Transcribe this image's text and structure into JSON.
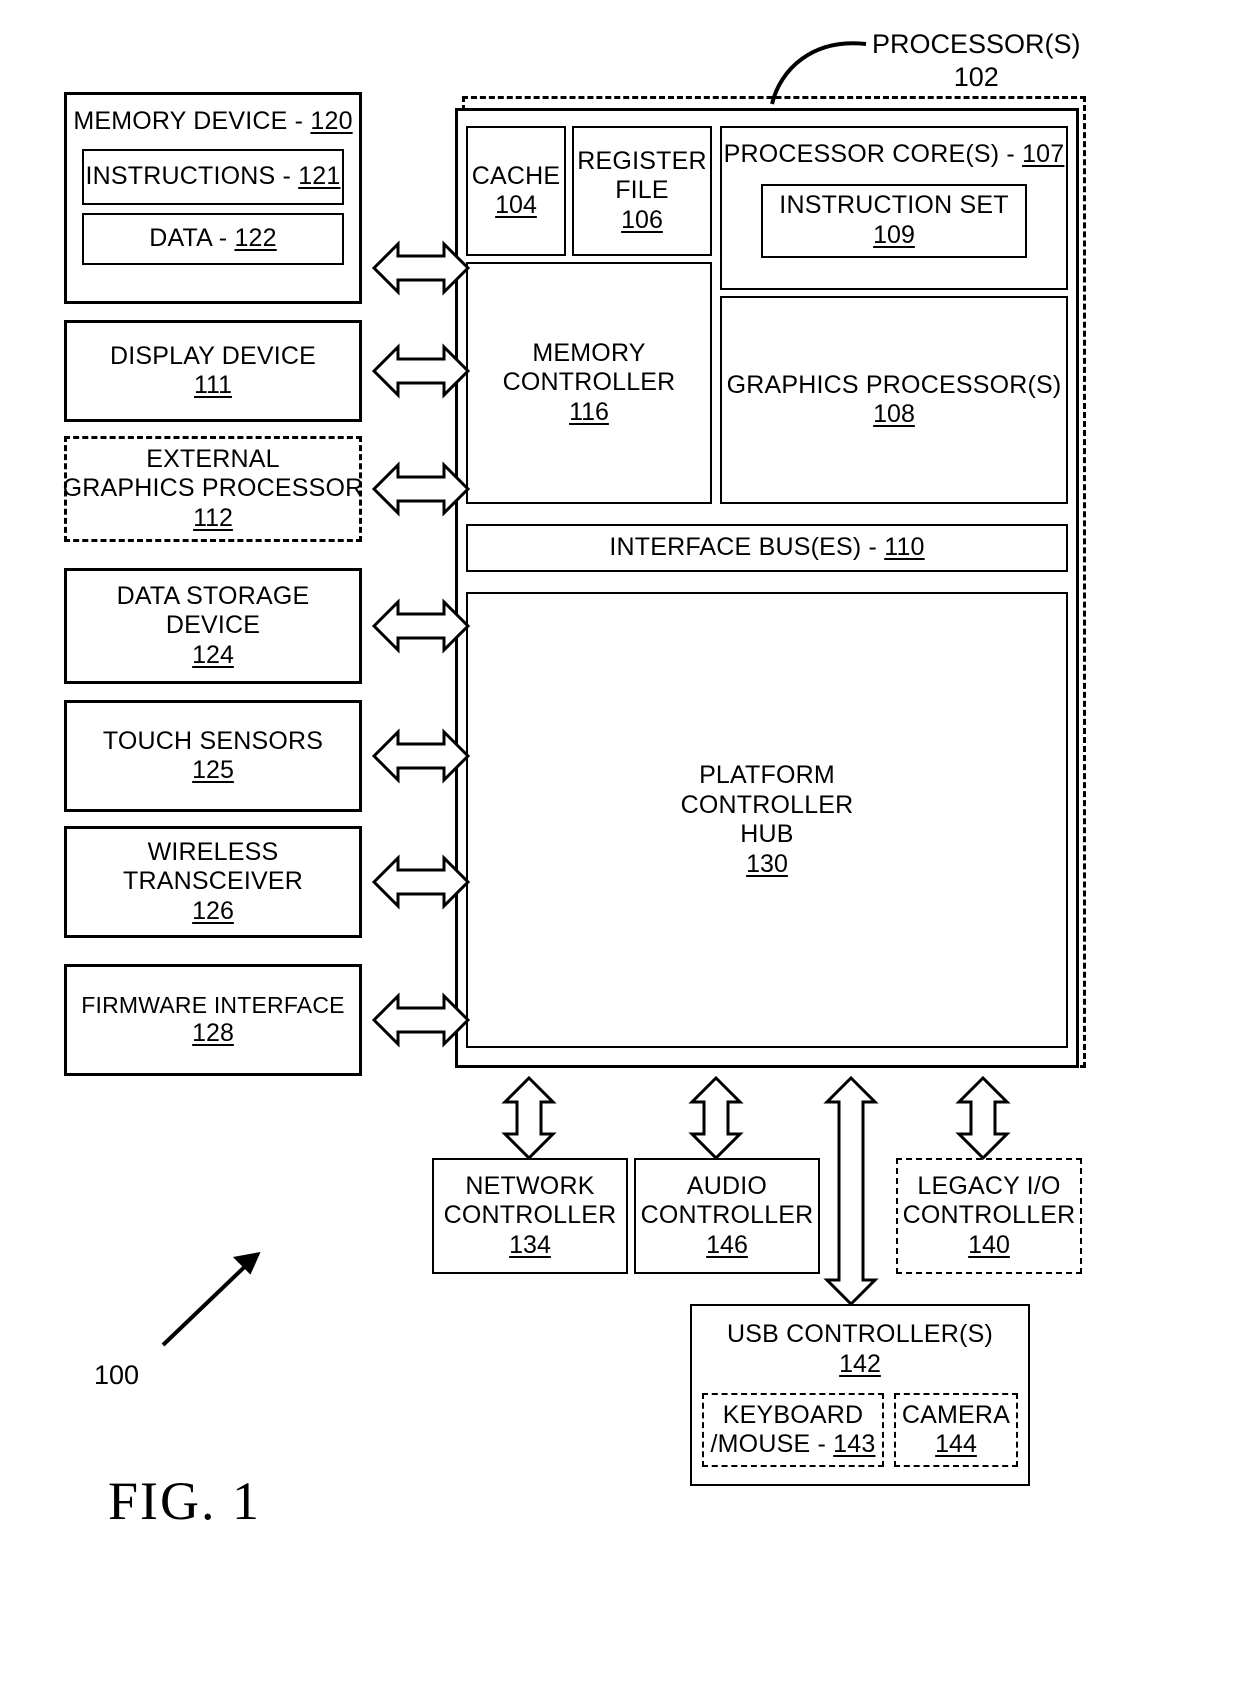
{
  "figure": {
    "label": "FIG. 1",
    "ref_number": "100"
  },
  "callouts": {
    "processor": {
      "title": "PROCESSOR(S)",
      "number": "102"
    }
  },
  "left_column": [
    {
      "name": "memory-device",
      "title": "MEMORY DEVICE - ",
      "number": "120",
      "style": "solid",
      "children": [
        {
          "name": "instructions",
          "title": "INSTRUCTIONS - ",
          "number": "121"
        },
        {
          "name": "data",
          "title": "DATA - ",
          "number": "122"
        }
      ]
    },
    {
      "name": "display-device",
      "line1": "DISPLAY DEVICE",
      "number": "111",
      "style": "solid"
    },
    {
      "name": "external-graphics-processor",
      "line1": "EXTERNAL",
      "line2": "GRAPHICS PROCESSOR",
      "number": "112",
      "style": "dashed"
    },
    {
      "name": "data-storage-device",
      "line1": "DATA STORAGE",
      "line2": "DEVICE",
      "number": "124",
      "style": "solid"
    },
    {
      "name": "touch-sensors",
      "line1": "TOUCH SENSORS",
      "number": "125",
      "style": "solid"
    },
    {
      "name": "wireless-transceiver",
      "line1": "WIRELESS",
      "line2": "TRANSCEIVER",
      "number": "126",
      "style": "solid"
    },
    {
      "name": "firmware-interface",
      "line1": "FIRMWARE INTERFACE",
      "number": "128",
      "style": "solid"
    }
  ],
  "processor": {
    "cache": {
      "title": "CACHE",
      "number": "104"
    },
    "register_file": {
      "line1": "REGISTER",
      "line2": "FILE",
      "number": "106"
    },
    "processor_cores": {
      "title": "PROCESSOR CORE(S) - ",
      "number": "107"
    },
    "instruction_set": {
      "title": "INSTRUCTION SET",
      "number": "109"
    },
    "memory_controller": {
      "line1": "MEMORY",
      "line2": "CONTROLLER",
      "number": "116"
    },
    "graphics_processor": {
      "title": "GRAPHICS PROCESSOR(S)",
      "number": "108"
    },
    "interface_bus": {
      "title": "INTERFACE BUS(ES) - ",
      "number": "110"
    },
    "platform_controller_hub": {
      "line1": "PLATFORM",
      "line2": "CONTROLLER",
      "line3": "HUB",
      "number": "130"
    }
  },
  "bottom_controllers": [
    {
      "name": "network-controller",
      "line1": "NETWORK",
      "line2": "CONTROLLER",
      "number": "134",
      "style": "solid"
    },
    {
      "name": "audio-controller",
      "line1": "AUDIO",
      "line2": "CONTROLLER",
      "number": "146",
      "style": "solid"
    },
    {
      "name": "legacy-io-controller",
      "line1": "LEGACY I/O",
      "line2": "CONTROLLER",
      "number": "140",
      "style": "dashed"
    }
  ],
  "usb": {
    "title": "USB CONTROLLER(S)",
    "number": "142",
    "children": [
      {
        "name": "keyboard-mouse",
        "line1": "KEYBOARD",
        "line2_prefix": "/MOUSE - ",
        "number": "143"
      },
      {
        "name": "camera",
        "line1": "CAMERA",
        "number": "144"
      }
    ]
  }
}
